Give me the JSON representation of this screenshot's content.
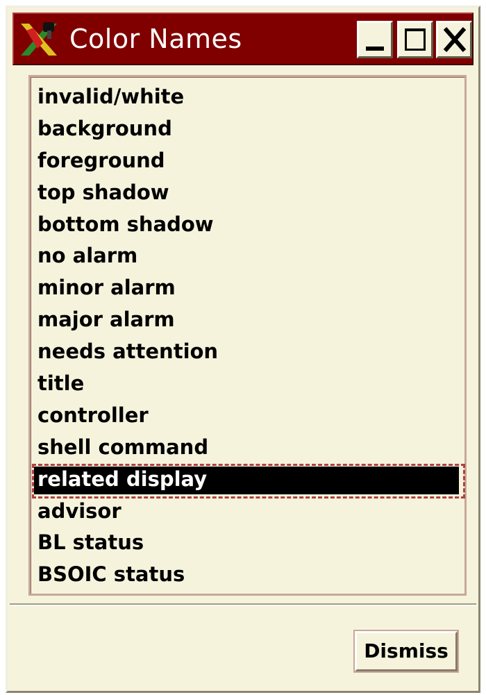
{
  "window": {
    "title": "Color Names",
    "icon": "x11-app-icon"
  },
  "titlebar_buttons": {
    "minimize": "minimize-icon",
    "maximize": "maximize-icon",
    "close": "close-icon"
  },
  "colors": {
    "titlebar": "#800000",
    "background": "#f5f3dc",
    "selection": "#000000",
    "focus_outline": "#b04040"
  },
  "list": {
    "items": [
      "invalid/white",
      "background",
      "foreground",
      "top shadow",
      "bottom shadow",
      "no alarm",
      "minor alarm",
      "major alarm",
      "needs attention",
      "title",
      "controller",
      "shell command",
      "related display",
      "advisor",
      "BL status",
      "BSOIC status"
    ],
    "selected": "related display"
  },
  "buttons": {
    "dismiss": "Dismiss"
  }
}
